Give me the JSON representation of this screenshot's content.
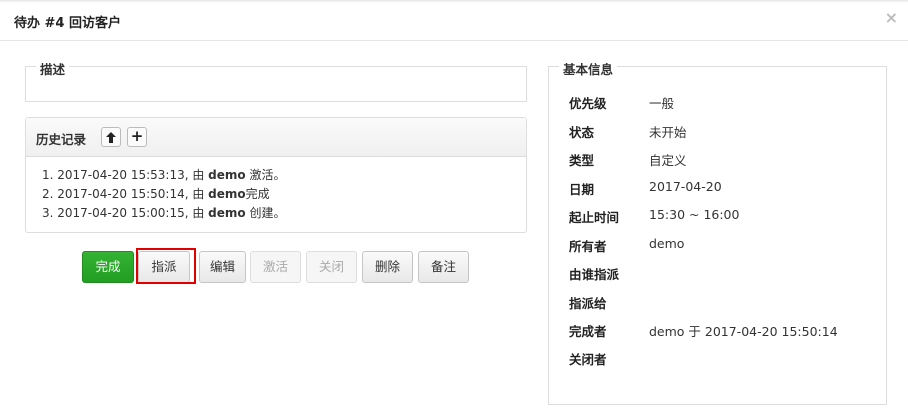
{
  "dialog": {
    "title": "待办 #4 回访客户",
    "close_glyph": "×"
  },
  "description": {
    "legend": "描述",
    "text": ""
  },
  "history": {
    "title": "历史记录",
    "up_glyph": "🡅",
    "add_glyph": "+",
    "entries": [
      {
        "prefix": "1. 2017-04-20 15:53:13, 由 ",
        "user": "demo",
        "suffix": " 激活。"
      },
      {
        "prefix": "2. 2017-04-20 15:50:14, 由 ",
        "user": "demo",
        "suffix": "完成"
      },
      {
        "prefix": "3. 2017-04-20 15:00:15, 由 ",
        "user": "demo",
        "suffix": " 创建。"
      }
    ]
  },
  "actions": {
    "finish": "完成",
    "assign": "指派",
    "edit": "编辑",
    "activate": "激活",
    "close": "关闭",
    "delete": "删除",
    "comment": "备注"
  },
  "basic_info": {
    "legend": "基本信息",
    "rows": [
      {
        "label": "优先级",
        "value": "一般"
      },
      {
        "label": "状态",
        "value": "未开始"
      },
      {
        "label": "类型",
        "value": "自定义"
      },
      {
        "label": "日期",
        "value": "2017-04-20"
      },
      {
        "label": "起止时间",
        "value": "15:30 ~ 16:00"
      },
      {
        "label": "所有者",
        "value": "demo"
      },
      {
        "label": "由谁指派",
        "value": ""
      },
      {
        "label": "指派给",
        "value": ""
      },
      {
        "label": "完成者",
        "value": "demo 于 2017-04-20 15:50:14"
      },
      {
        "label": "关闭者",
        "value": ""
      }
    ]
  },
  "colors": {
    "primary_green": "#2aa82a",
    "highlight_red": "#e00000"
  }
}
